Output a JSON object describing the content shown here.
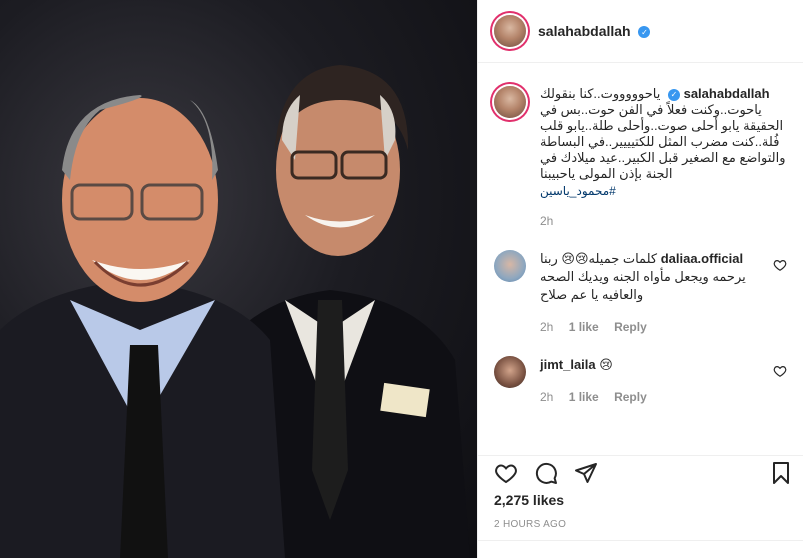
{
  "post": {
    "username": "salahabdallah",
    "caption": "ياحوووووت..كنا بنقولك ياحوت..وكنت فعلاً في الفن حوت..بس في الحقيقة يابو أحلى صوت..وأحلى طلة..يابو قلب فُلة..كنت مضرب المثل للكتيييير..في البساطة والتواضع مع الصغير قبل الكبير..عيد ميلادك في الجنة بإذن المولى ياحبيبنا",
    "hashtag": "#محمود_ياسين",
    "caption_time": "2h",
    "likes": "2,275 likes",
    "posted": "2 HOURS AGO",
    "comments": [
      {
        "user": "daliaa.official",
        "text": "كلمات جميله😢😢 ربنا يرحمه ويجعل مأواه الجنه ويديك الصحه والعافيه يا عم صلاح",
        "time": "2h",
        "likes": "1 like",
        "reply": "Reply"
      },
      {
        "user": "jimt_laila",
        "text": "😢",
        "time": "2h",
        "likes": "1 like",
        "reply": "Reply"
      }
    ]
  },
  "icons": [
    "heart-icon",
    "comment-icon",
    "share-icon",
    "save-icon",
    "verified-icon"
  ],
  "colors": {
    "accent": "#3897f0",
    "hashtag": "#00376b",
    "muted": "#8e8e8e"
  }
}
